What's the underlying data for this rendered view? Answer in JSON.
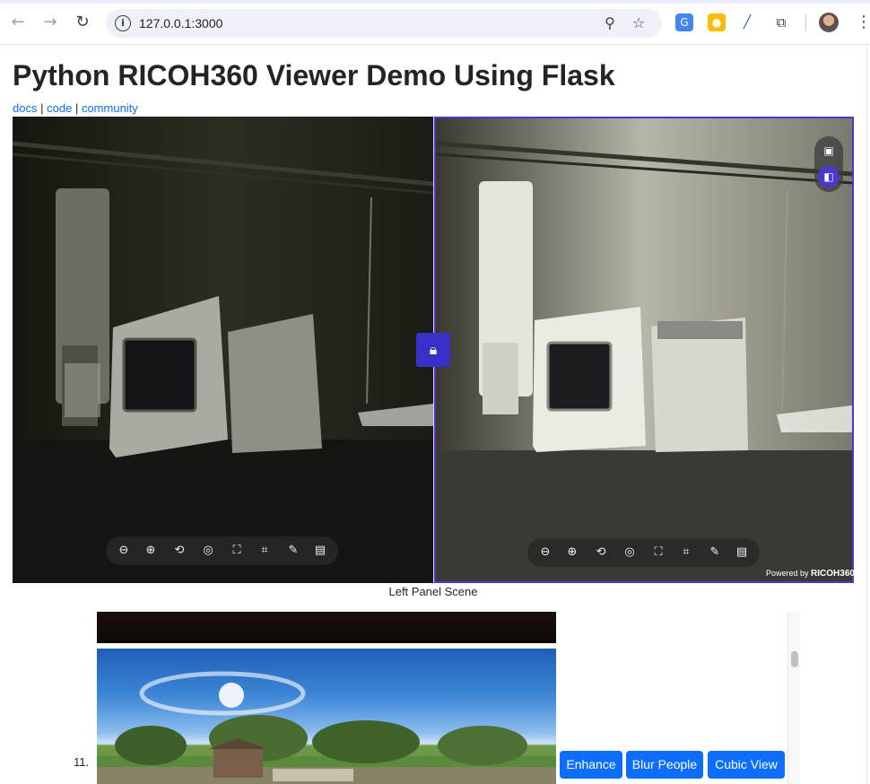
{
  "browser": {
    "url": "127.0.0.1:3000",
    "back_icon": "arrow-left-icon",
    "forward_icon": "arrow-right-icon",
    "reload_icon": "reload-icon",
    "info_icon": "info-icon",
    "zoom_icon": "zoom-icon",
    "star_icon": "star-icon",
    "extensions": [
      "google-translate-icon",
      "keep-icon",
      "pen-icon",
      "puzzle-icon"
    ]
  },
  "page": {
    "title": "Python RICOH360 Viewer Demo Using Flask",
    "links": [
      {
        "label": "docs"
      },
      {
        "label": "code"
      },
      {
        "label": "community"
      }
    ],
    "separator": "|"
  },
  "viewer": {
    "lock_icon": "lock-icon",
    "side_tools": [
      "image-icon",
      "compare-icon"
    ],
    "toolbar_icons": [
      "zoom-out-icon",
      "zoom-in-icon",
      "rotate-icon",
      "gyro-icon",
      "fullscreen-icon",
      "crop-icon",
      "magic-wand-icon",
      "comment-icon"
    ],
    "powered_by_prefix": "Powered by",
    "powered_by_brand": "RICOH360",
    "caption": "Left Panel Scene",
    "accent_color": "#4838d1"
  },
  "scene_list": {
    "item_number": "11.",
    "buttons": {
      "enhance": "Enhance",
      "blur_people": "Blur People",
      "cubic_view": "Cubic View"
    },
    "button_color": "#0d6efd"
  }
}
